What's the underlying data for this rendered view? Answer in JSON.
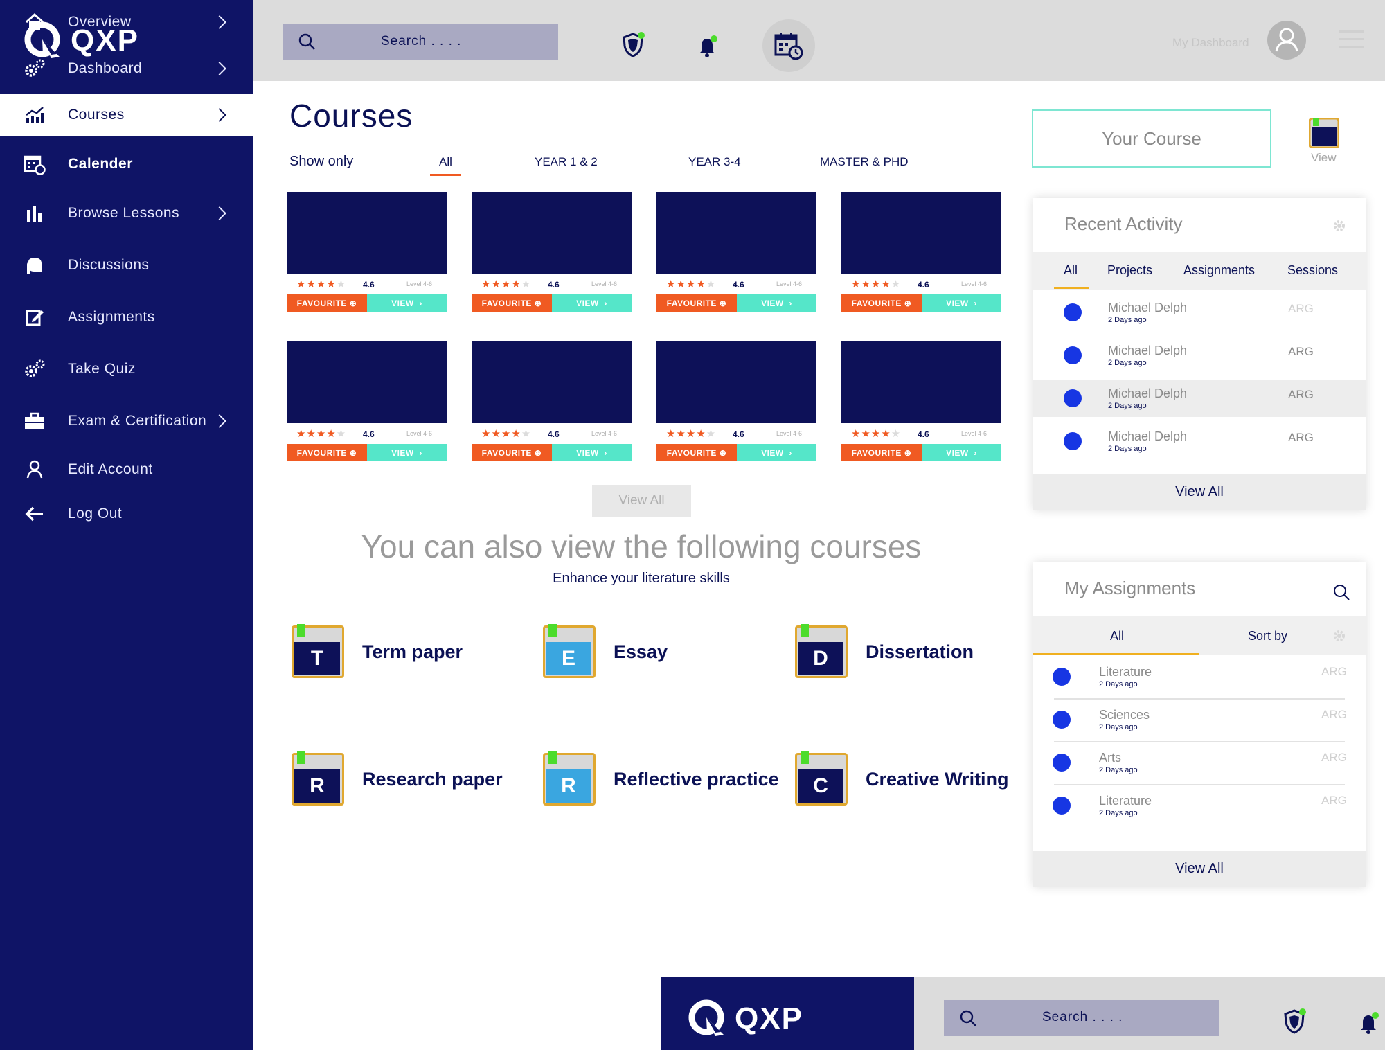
{
  "brand": {
    "name": "QXP"
  },
  "sidebar": {
    "items": [
      {
        "label": "Overview",
        "icon": "home-icon",
        "chevron": true
      },
      {
        "label": "Dashboard",
        "icon": "gears-icon",
        "chevron": true
      },
      {
        "label": "Courses",
        "icon": "chart-icon",
        "chevron": true,
        "active": true
      },
      {
        "label": "Calender",
        "icon": "calendar-icon",
        "chevron": false,
        "bold": true
      },
      {
        "label": "Browse Lessons",
        "icon": "bars-icon",
        "chevron": true
      },
      {
        "label": "Discussions",
        "icon": "chat-icon",
        "chevron": false
      },
      {
        "label": "Assignments",
        "icon": "edit-icon",
        "chevron": false
      },
      {
        "label": "Take Quiz",
        "icon": "gears-icon",
        "chevron": false
      },
      {
        "label": "Exam & Certification",
        "icon": "briefcase-icon",
        "chevron": true
      },
      {
        "label": "Edit Account",
        "icon": "user-icon",
        "chevron": false
      },
      {
        "label": "Log Out",
        "icon": "arrow-left-icon",
        "chevron": false
      }
    ]
  },
  "topbar": {
    "search_placeholder": "Search . . . .",
    "dashboard_label": "My Dashboard"
  },
  "main": {
    "title": "Courses",
    "show_only": "Show only",
    "filters": [
      "All",
      "YEAR 1 & 2",
      "YEAR 3-4",
      "MASTER & PHD"
    ],
    "card": {
      "rating": "4.6",
      "level": "Level 4-6",
      "favourite": "FAVOURITE",
      "view": "VIEW",
      "stars": 4
    },
    "view_all": "View All",
    "also_title": "You can also view the following courses",
    "also_subtitle": "Enhance your literature skills",
    "categories": [
      {
        "letter": "T",
        "label": "Term paper",
        "color": "#0d1158"
      },
      {
        "letter": "E",
        "label": "Essay",
        "color": "#3aa6e0"
      },
      {
        "letter": "D",
        "label": "Dissertation",
        "color": "#0d1158"
      },
      {
        "letter": "R",
        "label": "Research paper",
        "color": "#0d1158"
      },
      {
        "letter": "R",
        "label": "Reflective practice",
        "color": "#3aa6e0"
      },
      {
        "letter": "C",
        "label": "Creative Writing",
        "color": "#0d1158"
      }
    ]
  },
  "right": {
    "your_course": "Your Course",
    "view_label": "View",
    "recent": {
      "title": "Recent Activity",
      "tabs": [
        "All",
        "Projects",
        "Assignments",
        "Sessions"
      ],
      "rows": [
        {
          "name": "Michael Delph",
          "time": "2 Days ago",
          "tag": "ARG"
        },
        {
          "name": "Michael Delph",
          "time": "2 Days ago",
          "tag": "ARG"
        },
        {
          "name": "Michael Delph",
          "time": "2 Days ago",
          "tag": "ARG"
        },
        {
          "name": "Michael Delph",
          "time": "2 Days ago",
          "tag": "ARG"
        }
      ],
      "view_all": "View All"
    },
    "assignments": {
      "title": "My Assignments",
      "tabs": [
        "All",
        "Sort by"
      ],
      "rows": [
        {
          "name": "Literature",
          "time": "2 Days ago",
          "tag": "ARG"
        },
        {
          "name": "Sciences",
          "time": "2 Days ago",
          "tag": "ARG"
        },
        {
          "name": "Arts",
          "time": "2 Days ago",
          "tag": "ARG"
        },
        {
          "name": "Literature",
          "time": "2 Days ago",
          "tag": "ARG"
        }
      ],
      "view_all": "View All"
    }
  },
  "bottom": {
    "brand": "QXP",
    "search_placeholder": "Search . . . ."
  }
}
